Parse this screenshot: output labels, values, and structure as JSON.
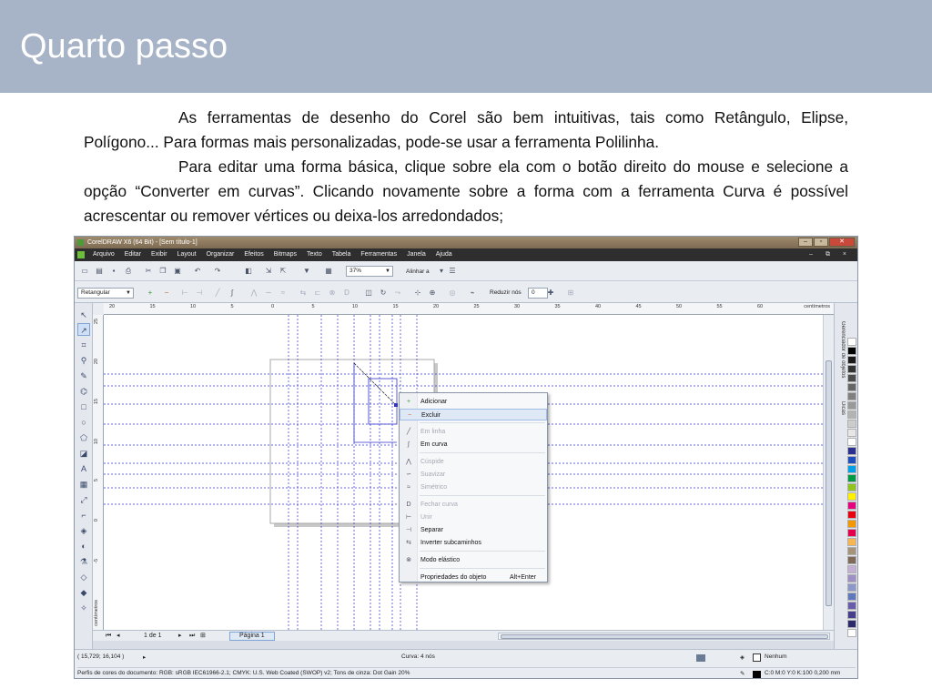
{
  "slide": {
    "title": "Quarto passo",
    "paragraph1": "As ferramentas de desenho do Corel são bem intuitivas, tais como Retângulo, Elipse, Polígono... Para formas mais personalizadas, pode-se usar a ferramenta Polilinha.",
    "paragraph2": "Para editar uma forma básica, clique sobre ela com o botão direito do mouse e selecione a opção “Converter em curvas”. Clicando novamente sobre a forma com a ferramenta Curva é possível acrescentar ou remover vértices ou deixa-los arredondados;"
  },
  "app": {
    "window_title": "CorelDRAW X6 (64 Bit) - [Sem título-1]",
    "menu": [
      "Arquivo",
      "Editar",
      "Exibir",
      "Layout",
      "Organizar",
      "Efeitos",
      "Bitmaps",
      "Texto",
      "Tabela",
      "Ferramentas",
      "Janela",
      "Ajuda"
    ],
    "mdi_controls": "– ⧉ ×",
    "zoom_value": "37%",
    "align_label": "Alinhar a",
    "object_type": "Retangular",
    "reduce_nodes_label": "Reduzir nós",
    "reduce_nodes_value": "0",
    "ruler_units": "centímetros",
    "ruler_units_vertical": "centímetros",
    "ruler_h_ticks": [
      "20",
      "15",
      "10",
      "5",
      "0",
      "5",
      "10",
      "15",
      "20",
      "25",
      "30",
      "35",
      "40",
      "45",
      "50",
      "55",
      "60"
    ],
    "ruler_v_ticks": [
      "25",
      "20",
      "15",
      "10",
      "5",
      "0",
      "-5"
    ],
    "page_counter": "1 de 1",
    "page_tab": "Página 1",
    "status_coords": "( 15,729; 16,104 )",
    "status_curve": "Curva: 4 nós",
    "status_fill_none": "Nenhum",
    "color_profile": "Perfis de cores do documento: RGB: sRGB IEC61966-2.1; CMYK: U.S. Web Coated (SWOP) v2; Tons de cinza: Dot Gain 20%",
    "outline_info": "C:0 M:0 Y:0 K:100  0,200 mm",
    "docker_tabs": [
      "Gerenciador de objetos",
      "Dicas"
    ]
  },
  "context_menu": {
    "items": [
      {
        "label": "Adicionar",
        "icon": "add-node-icon"
      },
      {
        "label": "Excluir",
        "icon": "delete-node-icon",
        "highlighted": true
      },
      {
        "label": "Em linha",
        "icon": "to-line-icon",
        "disabled": true
      },
      {
        "label": "Em curva",
        "icon": "to-curve-icon"
      },
      {
        "label": "Cúspide",
        "icon": "cusp-icon",
        "disabled": true
      },
      {
        "label": "Suavizar",
        "icon": "smooth-icon",
        "disabled": true
      },
      {
        "label": "Simétrico",
        "icon": "symmetric-icon",
        "disabled": true
      },
      {
        "label": "Fechar curva",
        "icon": "close-curve-icon",
        "disabled": true
      },
      {
        "label": "Unir",
        "icon": "join-icon",
        "disabled": true
      },
      {
        "label": "Separar",
        "icon": "break-icon"
      },
      {
        "label": "Inverter subcaminhos",
        "icon": "reverse-icon"
      },
      {
        "label": "Modo elástico",
        "icon": "elastic-icon"
      },
      {
        "label": "Propriedades do objeto",
        "shortcut": "Alt+Enter"
      }
    ]
  },
  "palette_colors": [
    "#ffffff",
    "#000000",
    "#1a1a1a",
    "#333333",
    "#4d4d4d",
    "#666666",
    "#808080",
    "#999999",
    "#b3b3b3",
    "#cccccc",
    "#e6e6e6",
    "#ffffff",
    "#2b2f8f",
    "#1f4fbf",
    "#00a0e9",
    "#009944",
    "#8fc31f",
    "#fff100",
    "#e4007f",
    "#e60012",
    "#f39800",
    "#e5004f",
    "#f8b551",
    "#a6937c",
    "#7e6b5a",
    "#c5b0d5",
    "#9e8fc4",
    "#8c97cb",
    "#5f79bc",
    "#6a5cad",
    "#463e8c",
    "#2c2a6b",
    "#ffffff"
  ]
}
